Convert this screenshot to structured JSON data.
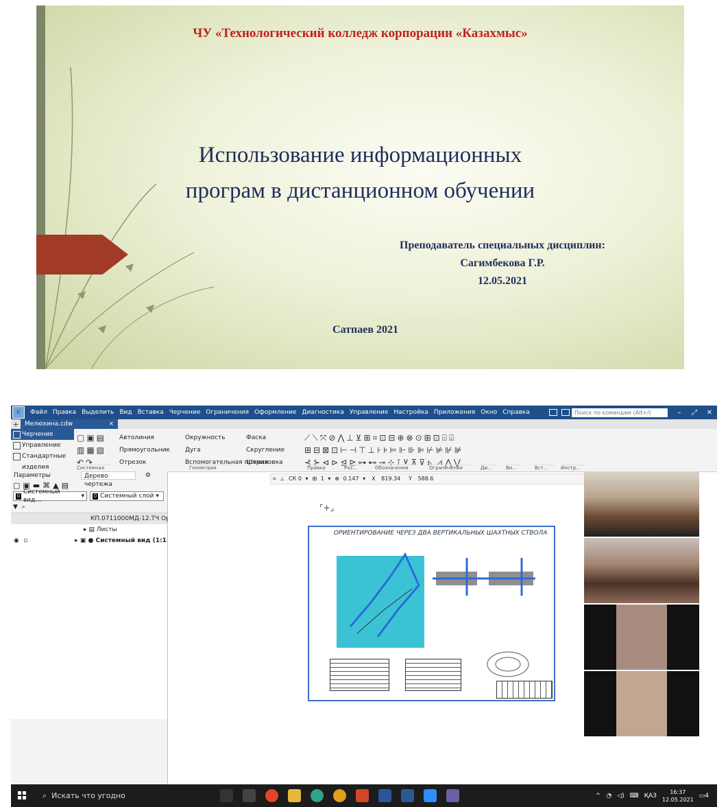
{
  "slide": {
    "organization": "ЧУ «Технологический колледж корпорации «Казахмыс»",
    "title_line1": "Использование информационных",
    "title_line2": "програм в дистанционном обучении",
    "teacher_role": "Преподаватель специальных дисциплин:",
    "teacher_name": "Сагимбекова Г.Р.",
    "date": "12.05.2021",
    "footer": "Сатпаев 2021",
    "accent_color": "#a13a26"
  },
  "app": {
    "menu": [
      "Файл",
      "Правка",
      "Выделить",
      "Вид",
      "Вставка",
      "Черчение",
      "Ограничения",
      "Оформление",
      "Диагностика",
      "Управление",
      "Настройка",
      "Приложения",
      "Окно",
      "Справка"
    ],
    "command_search_placeholder": "Поиск по командам (Alt+/)",
    "tab_name": "Мелюхина.cdw",
    "tab_close": "×",
    "ribbon_left": [
      "Черчение",
      "Управление",
      "Стандартные изделия"
    ],
    "ribbon_col1": [
      "Автолиния",
      "Прямоугольник",
      "Отрезок"
    ],
    "ribbon_col2": [
      "Окружность",
      "Дуга",
      "Вспомогательная прямая"
    ],
    "ribbon_col3": [
      "Фаска",
      "Скругление",
      "Штриховка"
    ],
    "groups": [
      "Системная",
      "Геометрия",
      "Правка",
      "Раз...",
      "Обозначения",
      "Ограничения",
      "Ди...",
      "Ви...",
      "Вст...",
      "Инстр..."
    ],
    "panel_tabs": [
      "Параметры",
      "Дерево чертежа"
    ],
    "view_dropdown": "Системный вид...",
    "layer_dropdown": "Системный слой",
    "layer_num": "0",
    "tree_items": [
      "КП.0711000МД-12.ТЧ Ор",
      "Листы",
      "● Системный вид (1:1"
    ],
    "toolbar2": {
      "cs": "СК 0",
      "layer": "1",
      "zoom": "0.147",
      "x_label": "X",
      "x": "819.34",
      "y_label": "Y",
      "y": "588.6"
    },
    "drawing_title": "ОРИЕНТИРОВАНИЕ ЧЕРЕЗ ДВА ВЕРТИКАЛЬНЫХ ШАХТНЫХ СТВОЛА"
  },
  "taskbar": {
    "search_placeholder": "Искать что угодно",
    "language": "ҚАЗ",
    "time": "16:37",
    "date": "12.05.2021",
    "notifications": "4"
  }
}
